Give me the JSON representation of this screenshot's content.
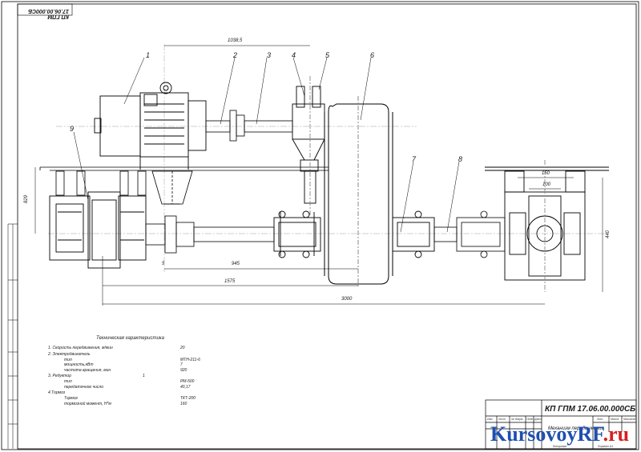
{
  "drawing_code": "КП ГПМ 17.06.00.000СБ",
  "corner_code": "КП ГПМ 17.06.00.000СБ",
  "title_block_name": "Механизм передвижения",
  "watermark": {
    "main": "KursovoyRF",
    "suffix": ".ru",
    "main_color": "#1f4fb0",
    "accent_color": "#d62020"
  },
  "callouts": [
    "1",
    "2",
    "3",
    "4",
    "5",
    "6",
    "7",
    "8",
    "9"
  ],
  "dimensions": {
    "d1038": "1038,5",
    "d829": "829",
    "d150": "150",
    "d100": "100",
    "d440": "440",
    "d5": "5",
    "d945": "945",
    "d1575": "1575",
    "d3000": "3000"
  },
  "specs": {
    "title": "Техническая характеристика",
    "rows": [
      {
        "label": "1. Скорость передвижения, м/мин",
        "value": "20"
      },
      {
        "label": "2. Электродвигатель",
        "value": ""
      },
      {
        "label": "тип",
        "value": "МТН-211-6"
      },
      {
        "label": "мощность,кВт",
        "value": "7"
      },
      {
        "label": "частота вращения, мин",
        "value": "920"
      },
      {
        "label": "3. Редуктор",
        "value": "1"
      },
      {
        "label": "тип",
        "value": "РМ-500"
      },
      {
        "label": "передаточное число",
        "value": "40,17"
      },
      {
        "label": "4.Тормоз",
        "value": ""
      },
      {
        "label": "Тормоз",
        "value": "ТКТ-200"
      },
      {
        "label": "тормозной момент, Н*м",
        "value": "160"
      }
    ]
  },
  "title_block_cells": [
    "Изм",
    "Лист",
    "№ докум.",
    "Подп.",
    "Дата",
    "Лит.",
    "Масса",
    "Масштаб",
    "Копировал",
    "Формат А1"
  ]
}
